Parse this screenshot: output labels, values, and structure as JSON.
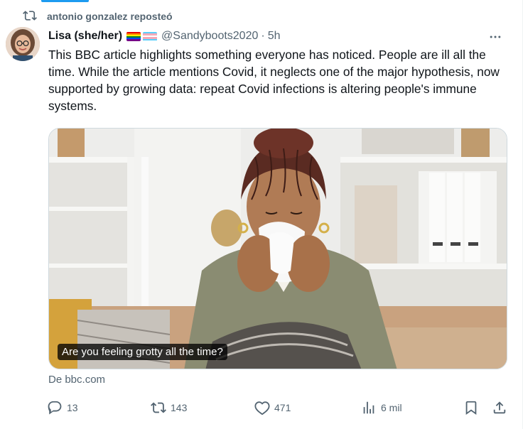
{
  "repost": {
    "icon": "repost-icon",
    "text": "antonio gonzalez reposteó"
  },
  "author": {
    "display_name": "Lisa (she/her)",
    "flags": [
      "rainbow-pride-flag",
      "transgender-pride-flag"
    ],
    "handle": "@Sandyboots2020",
    "separator": "·",
    "time": "5h"
  },
  "tweet": {
    "text": "This BBC article highlights something everyone has noticed. People are ill all the time. While the article mentions Covid, it neglects one of the major hypothesis, now supported by growing data: repeat Covid infections is altering people's immune systems."
  },
  "card": {
    "image_caption": "Are you feeling grotty all the time?",
    "source": "De bbc.com"
  },
  "actions": {
    "replies": "13",
    "reposts": "143",
    "likes": "471",
    "views": "6 mil"
  },
  "colors": {
    "accent": "#1d9bf0",
    "secondary_text": "#536471",
    "primary_text": "#0f1419"
  }
}
